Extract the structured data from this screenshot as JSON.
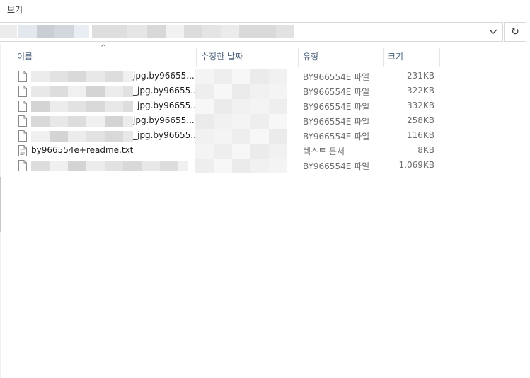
{
  "menu": {
    "view_label": "보기"
  },
  "addressbar": {
    "refresh_glyph": "↻",
    "chevron_icon": "chevron-down-icon"
  },
  "columns": {
    "name": "이름",
    "date_modified": "수정한 날짜",
    "type": "유형",
    "size": "크기",
    "sort_glyph": "^"
  },
  "files": [
    {
      "name_visible": "jpg.by96655...",
      "type": "BY966554E 파일",
      "size": "231KB",
      "name_redacted": true,
      "date_redacted": true
    },
    {
      "name_visible": "_jpg.by96655...",
      "type": "BY966554E 파일",
      "size": "322KB",
      "name_redacted": true,
      "date_redacted": true
    },
    {
      "name_visible": "_jpg.by96655...",
      "type": "BY966554E 파일",
      "size": "332KB",
      "name_redacted": true,
      "date_redacted": true
    },
    {
      "name_visible": "jpg.by96655...",
      "type": "BY966554E 파일",
      "size": "258KB",
      "name_redacted": true,
      "date_redacted": true
    },
    {
      "name_visible": "_jpg.by96655...",
      "type": "BY966554E 파일",
      "size": "116KB",
      "name_redacted": true,
      "date_redacted": true
    },
    {
      "name_visible": "by966554e+readme.txt",
      "type": "텍스트 문서",
      "size": "8KB",
      "name_redacted": false,
      "date_redacted": true
    },
    {
      "name_visible": "",
      "type": "BY966554E 파일",
      "size": "1,069KB",
      "name_redacted": true,
      "date_redacted": true
    }
  ],
  "colors": {
    "header_text": "#4c607a",
    "secondary_text": "#6d6d6d",
    "border": "#d9d9d9",
    "redaction_light": "#ebebeb",
    "redaction_dark": "#c8cdd3"
  }
}
